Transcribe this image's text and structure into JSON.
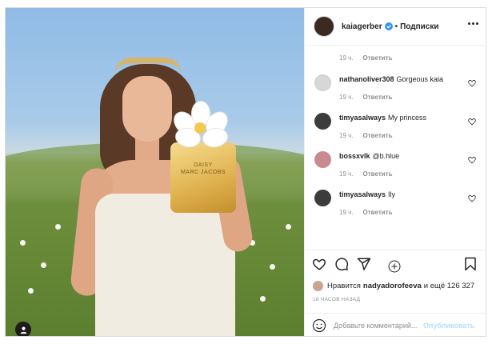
{
  "post": {
    "photo": {
      "bottle_label_line1": "DAISY",
      "bottle_label_line2": "MARC JACOBS"
    },
    "header": {
      "username": "kaiagerber",
      "separator": "•",
      "follow_status": "Подписки"
    },
    "top_meta": {
      "time": "19 ч.",
      "reply": "Ответить"
    },
    "comments": [
      {
        "username": "nathanoliver308",
        "text": "Gorgeous kaia",
        "time": "19 ч.",
        "reply": "Ответить"
      },
      {
        "username": "timyasalways",
        "text": "My princess",
        "time": "19 ч.",
        "reply": "Ответить"
      },
      {
        "username": "bossxvlk",
        "text": "@b.hlue",
        "time": "19 ч.",
        "reply": "Ответить"
      },
      {
        "username": "timyasalways",
        "text": "Ily",
        "time": "19 ч.",
        "reply": "Ответить"
      }
    ],
    "likes": {
      "prefix": "Нравится",
      "user": "nadyadorofeeva",
      "suffix": "и ещё 126 327"
    },
    "time_ago": "18 ЧАСОВ НАЗАД",
    "add_comment": {
      "placeholder": "Добавьте комментарий...",
      "publish_label": "Опубликовать"
    },
    "colors": {
      "verified_badge": "#3897f0",
      "publish_disabled": "#b2dffc",
      "muted_text": "#8e8e8e"
    },
    "icons": [
      "verified-icon",
      "more-icon",
      "heart-icon",
      "add-circle-icon",
      "comment-icon",
      "share-icon",
      "bookmark-icon",
      "emoji-icon",
      "user-tag-icon"
    ]
  }
}
